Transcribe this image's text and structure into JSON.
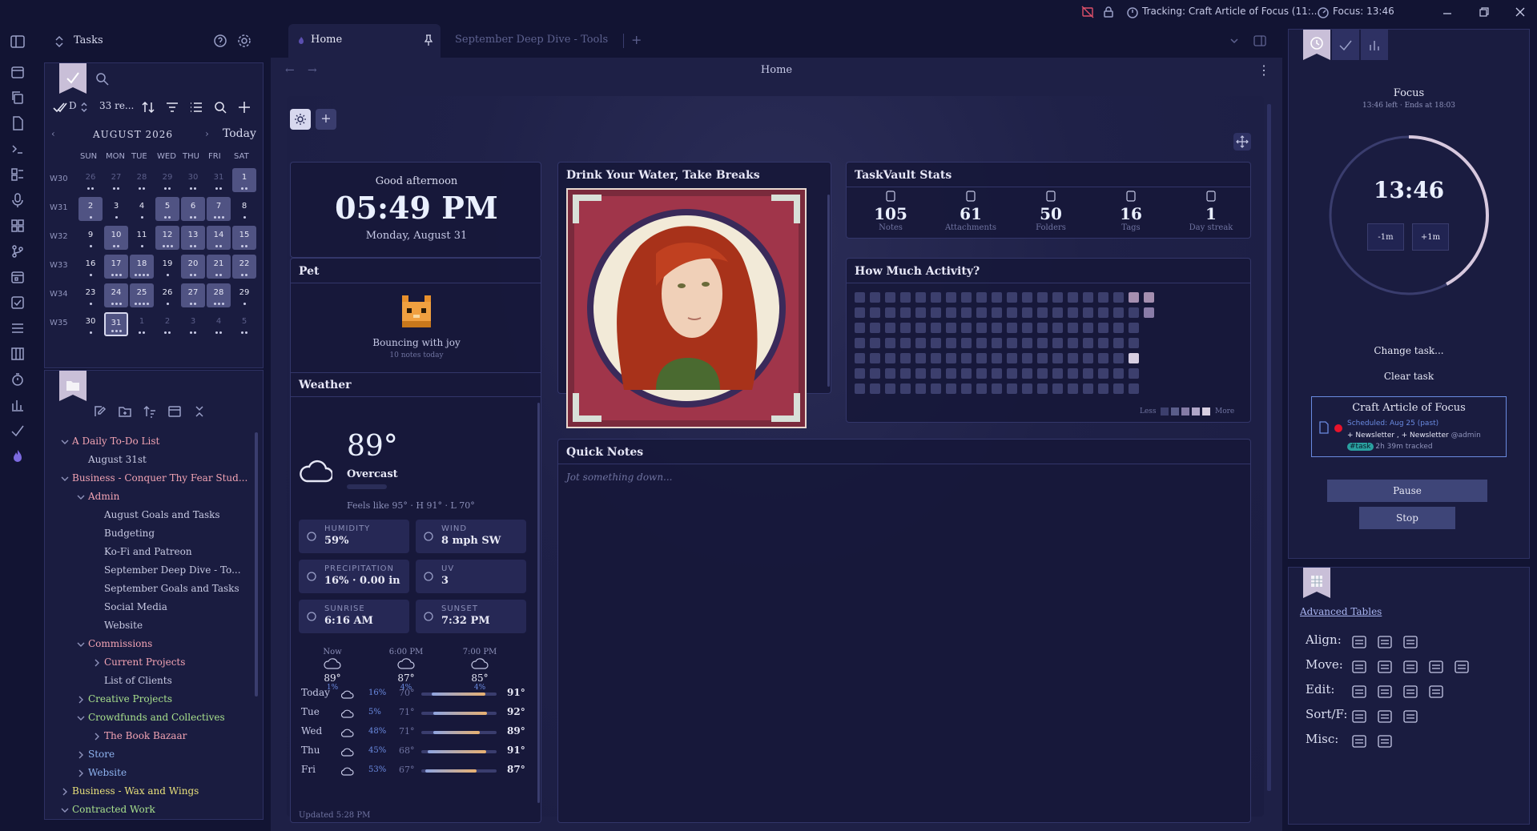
{
  "topbar": {
    "tracking": "Tracking: Craft Article of Focus (11:...",
    "focus": "Focus: 13:46"
  },
  "tasks_panel": {
    "title": "Tasks",
    "filter_count": "33 re...",
    "filter_letter": "D"
  },
  "calendar": {
    "month": "AUGUST 2026",
    "today_label": "Today",
    "weekdays": [
      "SUN",
      "MON",
      "TUE",
      "WED",
      "THU",
      "FRI",
      "SAT"
    ],
    "weeks": [
      {
        "label": "W30",
        "days": [
          "26",
          "27",
          "28",
          "29",
          "30",
          "31",
          "1"
        ]
      },
      {
        "label": "W31",
        "days": [
          "2",
          "3",
          "4",
          "5",
          "6",
          "7",
          "8"
        ]
      },
      {
        "label": "W32",
        "days": [
          "9",
          "10",
          "11",
          "12",
          "13",
          "14",
          "15"
        ]
      },
      {
        "label": "W33",
        "days": [
          "16",
          "17",
          "18",
          "19",
          "20",
          "21",
          "22"
        ]
      },
      {
        "label": "W34",
        "days": [
          "23",
          "24",
          "25",
          "26",
          "27",
          "28",
          "29"
        ]
      },
      {
        "label": "W35",
        "days": [
          "30",
          "31",
          "1",
          "2",
          "3",
          "4",
          "5"
        ]
      }
    ]
  },
  "tree": [
    {
      "label": "A Daily To-Do List",
      "level": 0,
      "open": true,
      "color": "#f2a3b3"
    },
    {
      "label": "August 31st",
      "level": 1,
      "leaf": true,
      "color": "#c7c9e2"
    },
    {
      "label": "Business - Conquer Thy Fear Stud...",
      "level": 0,
      "open": true,
      "color": "#f2a3b3"
    },
    {
      "label": "Admin",
      "level": 1,
      "open": true,
      "color": "#f2a3b3"
    },
    {
      "label": "August Goals and Tasks",
      "level": 2,
      "leaf": true,
      "color": "#c7c9e2"
    },
    {
      "label": "Budgeting",
      "level": 2,
      "leaf": true,
      "color": "#c7c9e2"
    },
    {
      "label": "Ko-Fi and Patreon",
      "level": 2,
      "leaf": true,
      "color": "#c7c9e2"
    },
    {
      "label": "September Deep Dive - To...",
      "level": 2,
      "leaf": true,
      "color": "#c7c9e2"
    },
    {
      "label": "September Goals and Tasks",
      "level": 2,
      "leaf": true,
      "color": "#c7c9e2"
    },
    {
      "label": "Social Media",
      "level": 2,
      "leaf": true,
      "color": "#c7c9e2"
    },
    {
      "label": "Website",
      "level": 2,
      "leaf": true,
      "color": "#c7c9e2"
    },
    {
      "label": "Commissions",
      "level": 1,
      "open": true,
      "color": "#f2a3b3"
    },
    {
      "label": "Current Projects",
      "level": 2,
      "open": false,
      "color": "#f2a3b3"
    },
    {
      "label": "List of Clients",
      "level": 2,
      "leaf": true,
      "color": "#c7c9e2"
    },
    {
      "label": "Creative Projects",
      "level": 1,
      "open": false,
      "color": "#a8e08c"
    },
    {
      "label": "Crowdfunds and Collectives",
      "level": 1,
      "open": true,
      "color": "#a8e08c"
    },
    {
      "label": "The Book Bazaar",
      "level": 2,
      "open": false,
      "color": "#f2a3b3"
    },
    {
      "label": "Store",
      "level": 1,
      "open": false,
      "color": "#8fb4f0"
    },
    {
      "label": "Website",
      "level": 1,
      "open": false,
      "color": "#8fb4f0"
    },
    {
      "label": "Business - Wax and Wings",
      "level": 0,
      "open": false,
      "color": "#e8e07a"
    },
    {
      "label": "Contracted Work",
      "level": 0,
      "open": true,
      "color": "#a8e08c"
    }
  ],
  "tabs": [
    {
      "label": "Home"
    },
    {
      "label": "September Deep Dive - Tools"
    }
  ],
  "header": {
    "title": "Home"
  },
  "clock": {
    "greeting": "Good afternoon",
    "time": "05:49 PM",
    "date": "Monday, August 31"
  },
  "pet": {
    "title": "Pet",
    "status": "Bouncing with joy",
    "sub": "10 notes today"
  },
  "weather": {
    "title": "Weather",
    "temp": "89°",
    "condition": "Overcast",
    "feels": "Feels like 95° · H 91° · L 70°",
    "stats": [
      {
        "label": "HUMIDITY",
        "value": "59%"
      },
      {
        "label": "WIND",
        "value": "8 mph SW"
      },
      {
        "label": "PRECIPITATION",
        "value": "16% · 0.00 in"
      },
      {
        "label": "UV",
        "value": "3"
      },
      {
        "label": "SUNRISE",
        "value": "6:16 AM"
      },
      {
        "label": "SUNSET",
        "value": "7:32 PM"
      }
    ],
    "hourly": [
      {
        "time": "Now",
        "temp": "89°",
        "pct": "1%"
      },
      {
        "time": "6:00 PM",
        "temp": "87°",
        "pct": "4%"
      },
      {
        "time": "7:00 PM",
        "temp": "85°",
        "pct": "4%"
      }
    ],
    "daily": [
      {
        "day": "Today",
        "pct": "16%",
        "low": "70°",
        "high": "91°"
      },
      {
        "day": "Tue",
        "pct": "5%",
        "low": "71°",
        "high": "92°"
      },
      {
        "day": "Wed",
        "pct": "48%",
        "low": "71°",
        "high": "89°"
      },
      {
        "day": "Thu",
        "pct": "45%",
        "low": "68°",
        "high": "91°"
      },
      {
        "day": "Fri",
        "pct": "53%",
        "low": "67°",
        "high": "87°"
      }
    ],
    "updated": "Updated 5:28 PM"
  },
  "image_card": {
    "title": "Drink Your Water, Take Breaks"
  },
  "stats": {
    "title": "TaskVault Stats",
    "items": [
      {
        "value": "105",
        "label": "Notes"
      },
      {
        "value": "61",
        "label": "Attachments"
      },
      {
        "value": "50",
        "label": "Folders"
      },
      {
        "value": "16",
        "label": "Tags"
      },
      {
        "value": "1",
        "label": "Day streak"
      }
    ]
  },
  "activity": {
    "title": "How Much Activity?",
    "less": "Less",
    "more": "More"
  },
  "notes": {
    "title": "Quick Notes",
    "placeholder": "Jot something down..."
  },
  "focus": {
    "title": "Focus",
    "sub": "13:46 left · Ends at 18:03",
    "time": "13:46",
    "progress": 0.42,
    "minus": "-1m",
    "plus": "+1m",
    "change": "Change task...",
    "clear": "Clear task",
    "task_title": "Craft Article of Focus",
    "scheduled": "Scheduled: Aug 25 (past)",
    "link1": "Newsletter",
    "link2": "Newsletter",
    "mention": "@admin",
    "tag": "#task",
    "tracked": "2h 39m tracked",
    "pause": "Pause",
    "stop": "Stop"
  },
  "tables": {
    "link": "Advanced Tables",
    "rows": [
      "Align:",
      "Move:",
      "Edit:",
      "Sort/F:",
      "Misc:"
    ]
  },
  "colors": {
    "accent": "#c9bfd8",
    "background": "#121433",
    "panel": "#1a1c40",
    "task_dot": "#e8132b"
  }
}
